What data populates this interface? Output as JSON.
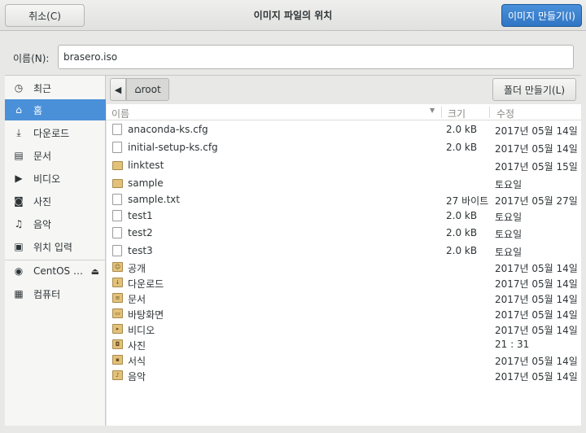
{
  "header": {
    "cancel_label": "취소(C)",
    "title": "이미지 파일의 위치",
    "create_label": "이미지 만들기(I)"
  },
  "name_field": {
    "label": "이름(N):",
    "value": "brasero.iso"
  },
  "sidebar": {
    "items": [
      {
        "label": "최근",
        "icon": "clock-icon",
        "glyph": "◷"
      },
      {
        "label": "홈",
        "icon": "home-icon",
        "glyph": "⌂",
        "active": true
      },
      {
        "label": "다운로드",
        "icon": "download-icon",
        "glyph": "⤓"
      },
      {
        "label": "문서",
        "icon": "document-icon",
        "glyph": "▤"
      },
      {
        "label": "비디오",
        "icon": "video-icon",
        "glyph": "▶"
      },
      {
        "label": "사진",
        "icon": "camera-icon",
        "glyph": "◙"
      },
      {
        "label": "음악",
        "icon": "music-icon",
        "glyph": "♫"
      },
      {
        "label": "위치 입력",
        "icon": "location-icon",
        "glyph": "▣"
      },
      {
        "label": "CentOS …",
        "icon": "disc-icon",
        "glyph": "◉"
      },
      {
        "label": "컴퓨터",
        "icon": "computer-icon",
        "glyph": "▦"
      }
    ],
    "eject_glyph": "⏏"
  },
  "pathbar": {
    "back_glyph": "◀",
    "root_glyph": "⌂",
    "root_label": "root",
    "new_folder_label": "폴더 만들기(L)"
  },
  "columns": {
    "name": "이름",
    "size": "크기",
    "modified": "수정",
    "sort_glyph": "▼"
  },
  "files": [
    {
      "name": "anaconda-ks.cfg",
      "size": "2.0 kB",
      "modified": "2017년 05월 14일",
      "type": "file"
    },
    {
      "name": "initial-setup-ks.cfg",
      "size": "2.0 kB",
      "modified": "2017년 05월 14일",
      "type": "file"
    },
    {
      "name": "linktest",
      "size": "",
      "modified": "2017년 05월 15일",
      "type": "folder"
    },
    {
      "name": "sample",
      "size": "",
      "modified": "토요일",
      "type": "folder"
    },
    {
      "name": "sample.txt",
      "size": "27 바이트",
      "modified": "2017년 05월 27일",
      "type": "file"
    },
    {
      "name": "test1",
      "size": "2.0 kB",
      "modified": "토요일",
      "type": "file"
    },
    {
      "name": "test2",
      "size": "2.0 kB",
      "modified": "토요일",
      "type": "file"
    },
    {
      "name": "test3",
      "size": "2.0 kB",
      "modified": "토요일",
      "type": "file"
    },
    {
      "name": "공개",
      "size": "",
      "modified": "2017년 05월 14일",
      "type": "special",
      "glyph": "☺"
    },
    {
      "name": "다운로드",
      "size": "",
      "modified": "2017년 05월 14일",
      "type": "special",
      "glyph": "↓"
    },
    {
      "name": "문서",
      "size": "",
      "modified": "2017년 05월 14일",
      "type": "special",
      "glyph": "≡"
    },
    {
      "name": "바탕화면",
      "size": "",
      "modified": "2017년 05월 14일",
      "type": "special",
      "glyph": "▭"
    },
    {
      "name": "비디오",
      "size": "",
      "modified": "2017년 05월 14일",
      "type": "special",
      "glyph": "▸"
    },
    {
      "name": "사진",
      "size": "",
      "modified": "21 : 31",
      "type": "special",
      "glyph": "◘"
    },
    {
      "name": "서식",
      "size": "",
      "modified": "2017년 05월 14일",
      "type": "special",
      "glyph": "▪"
    },
    {
      "name": "음악",
      "size": "",
      "modified": "2017년 05월 14일",
      "type": "special",
      "glyph": "♪"
    }
  ]
}
